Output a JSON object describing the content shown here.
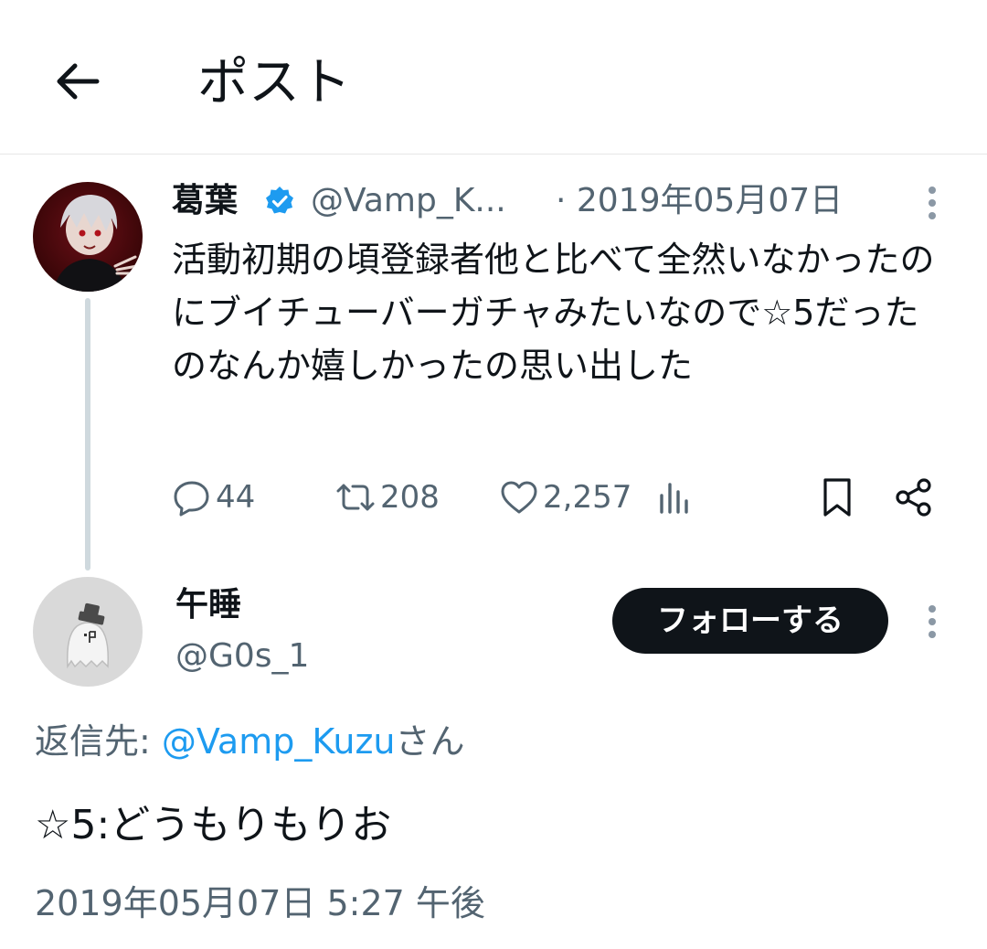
{
  "header": {
    "back_icon": "arrow-left-icon",
    "title": "ポスト"
  },
  "original_tweet": {
    "avatar": "avatar",
    "name": "葛葉",
    "verified_icon": "verified-badge-icon",
    "handle": "@Vamp_K...",
    "date": "· 2019年05月07日",
    "text": "活動初期の頃登録者他と比べて全然いなかったのにブイチューバーガチャみたいなので☆5だったのなんか嬉しかったの思い出した",
    "actions": {
      "reply_count": "44",
      "retweet_count": "208",
      "like_count": "2,257"
    },
    "icons": {
      "reply": "reply-icon",
      "retweet": "retweet-icon",
      "like": "heart-icon",
      "views": "views-icon",
      "bookmark": "bookmark-icon",
      "share": "share-icon",
      "more": "more-vertical-icon"
    }
  },
  "reply_tweet": {
    "name": "午睡",
    "handle": "@G0s_1",
    "follow_label": "フォローする",
    "reply_to_prefix": "返信先: ",
    "reply_to_mention": "@Vamp_Kuzu",
    "reply_to_suffix": "さん",
    "text": "☆5:どうもりもりお",
    "timestamp": "2019年05月07日 5:27 午後"
  },
  "colors": {
    "text_primary": "#0f1419",
    "text_secondary": "#536471",
    "accent": "#1d9bf0",
    "thread_line": "#cfd9de",
    "follow_bg": "#0f1419"
  }
}
